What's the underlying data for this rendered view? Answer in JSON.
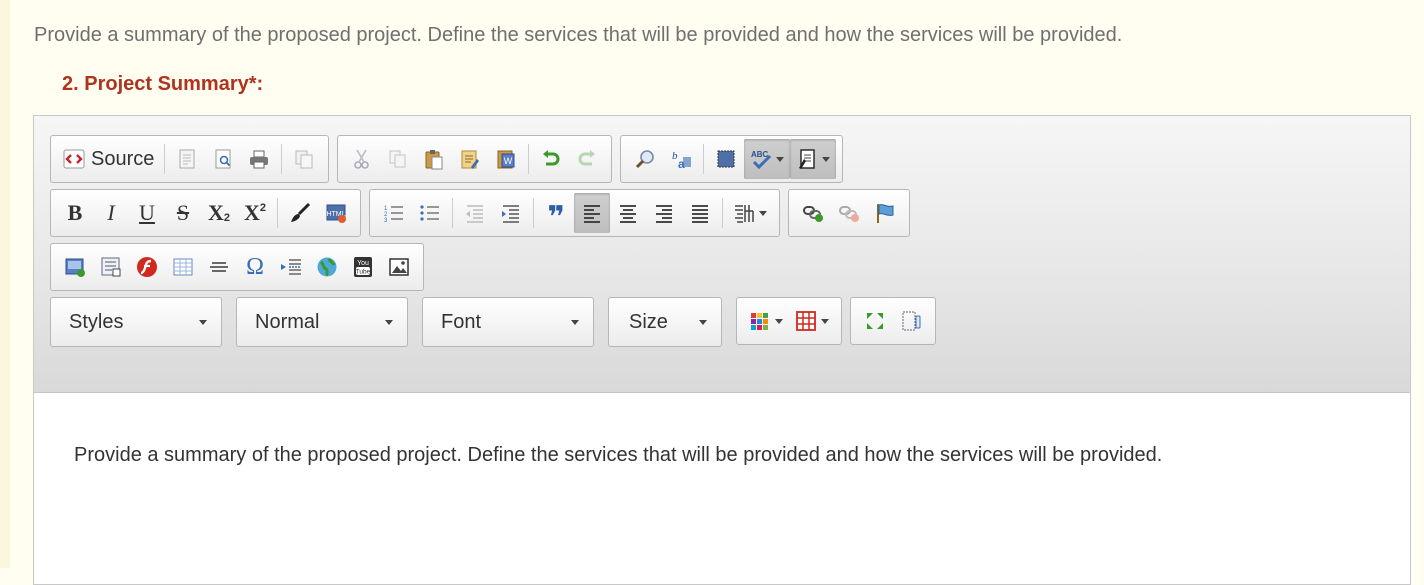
{
  "page": {
    "instructions": "Provide a summary of the proposed project. Define the services that will be provided and how the services will be provided.",
    "field_label": "2. Project Summary*:"
  },
  "toolbar": {
    "source_label": "Source",
    "rows": [
      [
        [
          "source",
          "templates",
          "preview",
          "print",
          "paste-plain"
        ],
        [
          "cut",
          "copy",
          "paste",
          "paste-text",
          "paste-word",
          "undo",
          "redo"
        ],
        [
          "find",
          "replace",
          "select-all",
          "spellcheck",
          "document-props"
        ]
      ],
      [
        [
          "bold",
          "italic",
          "underline",
          "strike",
          "subscript",
          "superscript",
          "remove-format",
          "html"
        ],
        [
          "numbered-list",
          "bulleted-list",
          "outdent",
          "indent",
          "blockquote",
          "align-left",
          "align-center",
          "align-right",
          "justify",
          "language"
        ],
        [
          "link",
          "unlink",
          "anchor"
        ]
      ],
      [
        [
          "image",
          "insert-form",
          "flash",
          "table",
          "horizontal-rule",
          "special-char",
          "page-break",
          "iframe",
          "youtube",
          "picture"
        ]
      ]
    ],
    "letters": {
      "bold": "B",
      "italic": "I",
      "underline": "U",
      "strike": "S",
      "subscript": "X",
      "superscript": "X",
      "special_char": "Ω",
      "blockquote": "❞"
    },
    "combos": {
      "styles": "Styles",
      "format": "Normal",
      "font": "Font",
      "size": "Size"
    },
    "active": [
      "spellcheck",
      "document-props",
      "align-left"
    ],
    "colors": {
      "accent_red": "#b0331e",
      "green": "#3a9a2a",
      "blue": "#3a6fb7"
    }
  },
  "editor": {
    "content": "Provide a summary of the proposed project. Define the services that will be provided and how the services will be provided."
  }
}
